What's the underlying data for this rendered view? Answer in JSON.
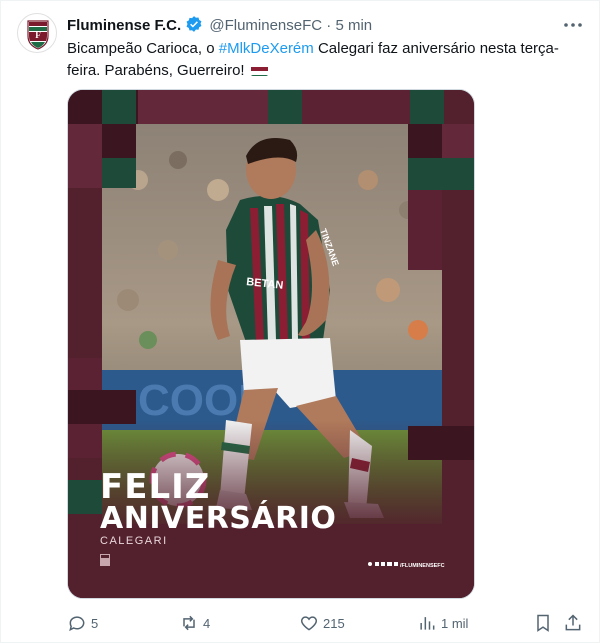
{
  "tweet": {
    "author_name": "Fluminense F.C.",
    "handle": "@FluminenseFC",
    "separator": "·",
    "time": "5 min",
    "text_before": "Bicampeão Carioca, o ",
    "hashtag": "#MlkDeXerém",
    "text_after": " Calegari faz aniversário nesta terça-feira. Parabéns, Guerreiro! ",
    "flag_icon": "fluminense-flag-icon"
  },
  "media": {
    "headline_line1": "FELIZ",
    "headline_line2": "ANIVERSÁRIO",
    "player_name": "CALEGARI",
    "social_handle": "/FLUMINENSEFC",
    "ad_board_text": "COOB",
    "shirt_text": "TINZANE",
    "chest_text": "BETAN"
  },
  "actions": {
    "replies": "5",
    "retweets": "4",
    "likes": "215",
    "views": "1 mil"
  },
  "colors": {
    "maroon": "#53202d",
    "dark_maroon": "#3b1520",
    "green": "#1e4a3a",
    "link": "#1d9bf0",
    "muted": "#536471"
  }
}
